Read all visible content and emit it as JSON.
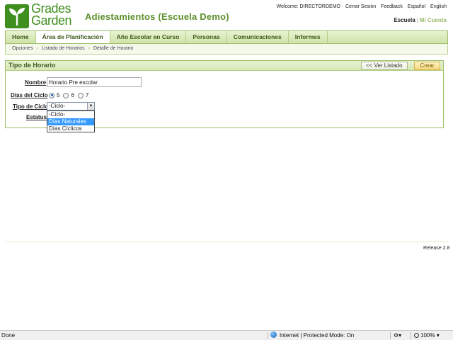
{
  "header": {
    "logo_text_line1": "Grades",
    "logo_text_line2": "Garden",
    "school_title": "Adiestamientos (Escuela Demo)",
    "welcome": "Welcome: DIRECTORDEMO",
    "links": [
      "Cerrar Sesión",
      "Feedback",
      "Español",
      "English"
    ],
    "escuela_label": "Escuela",
    "mi_cuenta_label": "Mi Cuenta"
  },
  "nav": {
    "items": [
      "Home",
      "Área de Planificación",
      "Año Escolar en Curso",
      "Personas",
      "Comunicaciones",
      "Informes"
    ],
    "active_index": 1
  },
  "breadcrumb": [
    "Opciones",
    "Listado de Horarios",
    "Detalle de Horario"
  ],
  "panel": {
    "title": "Tipo de Horario",
    "list_button": "<< Ver Listado",
    "create_button": "Crear"
  },
  "form": {
    "nombre_label": "Nombre",
    "nombre_value": "Horario Pre escolar",
    "dias_label": "Días del Ciclo",
    "dias_options": [
      "5",
      "6",
      "7"
    ],
    "dias_selected": "5",
    "tipo_label": "Tipo de Ciclo",
    "tipo_value": "-Ciclo-",
    "tipo_options": [
      "-Ciclo-",
      "Días Naturales",
      "Días Cíclicos"
    ],
    "tipo_highlighted": "Días Naturales",
    "estatus_label": "Estatus"
  },
  "footer": {
    "release": "Release 2.8"
  },
  "statusbar": {
    "done": "Done",
    "zone": "Internet | Protected Mode: On",
    "zoom": "100%"
  },
  "colors": {
    "brand_green": "#3f8f1f",
    "title_green": "#5d8f2a",
    "highlight_blue": "#3399ff",
    "create_yellow": "#f5d77a"
  }
}
